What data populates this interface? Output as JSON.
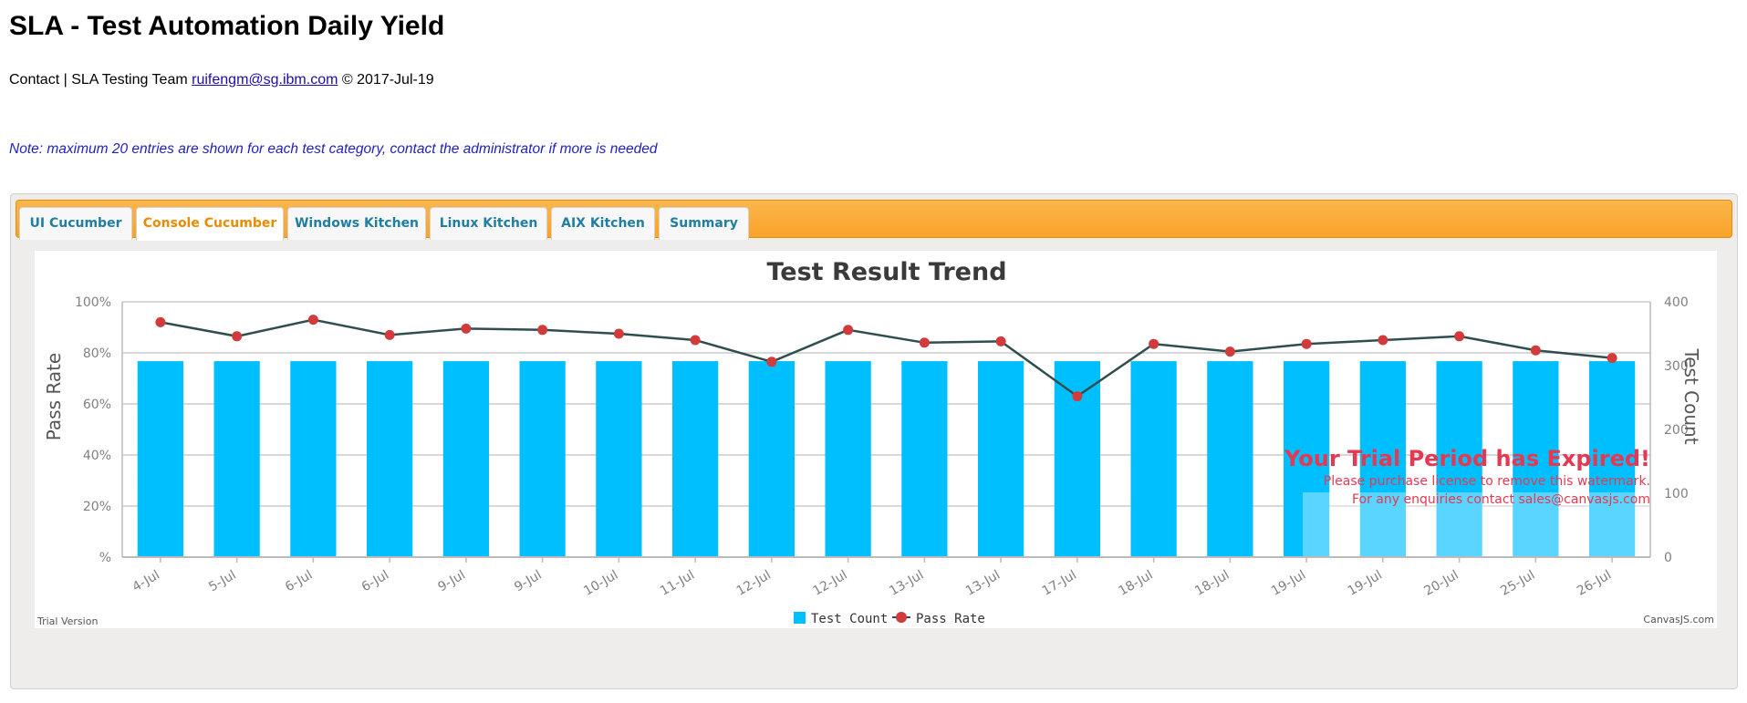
{
  "header": {
    "title": "SLA - Test Automation Daily Yield",
    "contact_prefix": "Contact | SLA Testing Team",
    "contact_email": "ruifengm@sg.ibm.com",
    "contact_suffix": "© 2017-Jul-19",
    "note": "Note: maximum 20 entries are shown for each test category, contact the administrator if more is needed"
  },
  "tabs": [
    {
      "label": "UI Cucumber",
      "active": false
    },
    {
      "label": "Console Cucumber",
      "active": true
    },
    {
      "label": "Windows Kitchen",
      "active": false
    },
    {
      "label": "Linux Kitchen",
      "active": false
    },
    {
      "label": "AIX Kitchen",
      "active": false
    },
    {
      "label": "Summary",
      "active": false
    }
  ],
  "colors": {
    "tab_bar": "#f9a32a",
    "bar": "#00bfff",
    "line": "#2f4f4f",
    "marker": "#d13b3b",
    "watermark": "#e53953"
  },
  "chart_data": {
    "type": "bar",
    "title": "Test Result Trend",
    "categories": [
      "4-Jul",
      "5-Jul",
      "6-Jul",
      "6-Jul",
      "9-Jul",
      "9-Jul",
      "10-Jul",
      "11-Jul",
      "12-Jul",
      "12-Jul",
      "13-Jul",
      "13-Jul",
      "17-Jul",
      "18-Jul",
      "18-Jul",
      "19-Jul",
      "19-Jul",
      "20-Jul",
      "25-Jul",
      "26-Jul"
    ],
    "series": [
      {
        "name": "Test Count",
        "type": "bar",
        "axis": "right",
        "values": [
          307,
          307,
          307,
          307,
          307,
          307,
          307,
          307,
          307,
          307,
          307,
          307,
          307,
          307,
          307,
          307,
          307,
          307,
          307,
          307
        ]
      },
      {
        "name": "Pass Rate",
        "type": "line",
        "axis": "left",
        "values": [
          92,
          86.5,
          93,
          87,
          89.5,
          89,
          87.5,
          85,
          76.5,
          89,
          84,
          84.5,
          63,
          83.5,
          80.5,
          83.5,
          85,
          86.5,
          81,
          78
        ]
      }
    ],
    "ylabel_left": "Pass Rate",
    "ylabel_right": "Test Count",
    "yticks_left": [
      "%",
      "20%",
      "40%",
      "60%",
      "80%",
      "100%"
    ],
    "yticks_right": [
      "0",
      "100",
      "200",
      "300",
      "400"
    ],
    "ylim_left": [
      0,
      100
    ],
    "ylim_right": [
      0,
      400
    ],
    "grid": true,
    "legend": "bottom-center"
  },
  "watermark": {
    "title": "Your Trial Period has Expired!",
    "line1": "Please purchase license to remove this watermark.",
    "line2": "For any enquiries contact sales@canvasjs.com"
  },
  "footer": {
    "trial": "Trial Version",
    "credit": "CanvasJS.com"
  }
}
